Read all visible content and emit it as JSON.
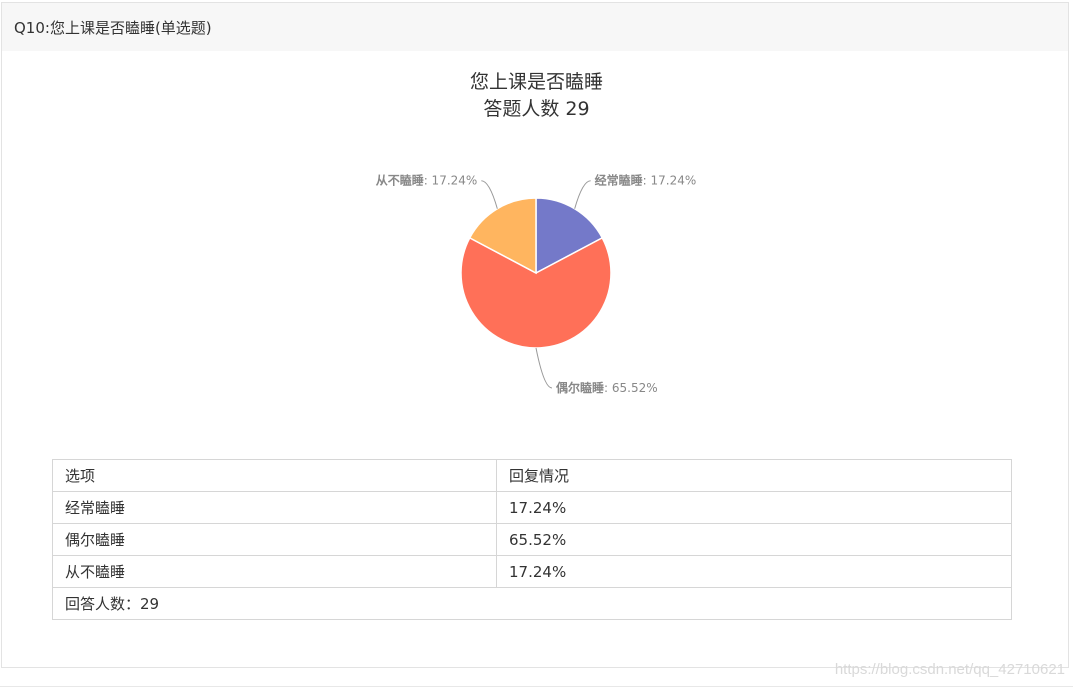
{
  "header": {
    "question": "Q10:您上课是否瞌睡(单选题)"
  },
  "chart_data": {
    "type": "pie",
    "title": "您上课是否瞌睡",
    "subtitle": "答题人数 29",
    "categories": [
      "经常瞌睡",
      "偶尔瞌睡",
      "从不瞌睡"
    ],
    "values": [
      17.24,
      65.52,
      17.24
    ],
    "value_labels": [
      "17.24%",
      "65.52%",
      "17.24%"
    ],
    "colors": [
      "#7479c9",
      "#ff7058",
      "#ffb55f"
    ],
    "legend": "none"
  },
  "table": {
    "headers": [
      "选项",
      "回复情况"
    ],
    "rows": [
      [
        "经常瞌睡",
        "17.24%"
      ],
      [
        "偶尔瞌睡",
        "65.52%"
      ],
      [
        "从不瞌睡",
        "17.24%"
      ]
    ],
    "footer": "回答人数：29"
  },
  "watermark": "https://blog.csdn.net/qq_42710621"
}
